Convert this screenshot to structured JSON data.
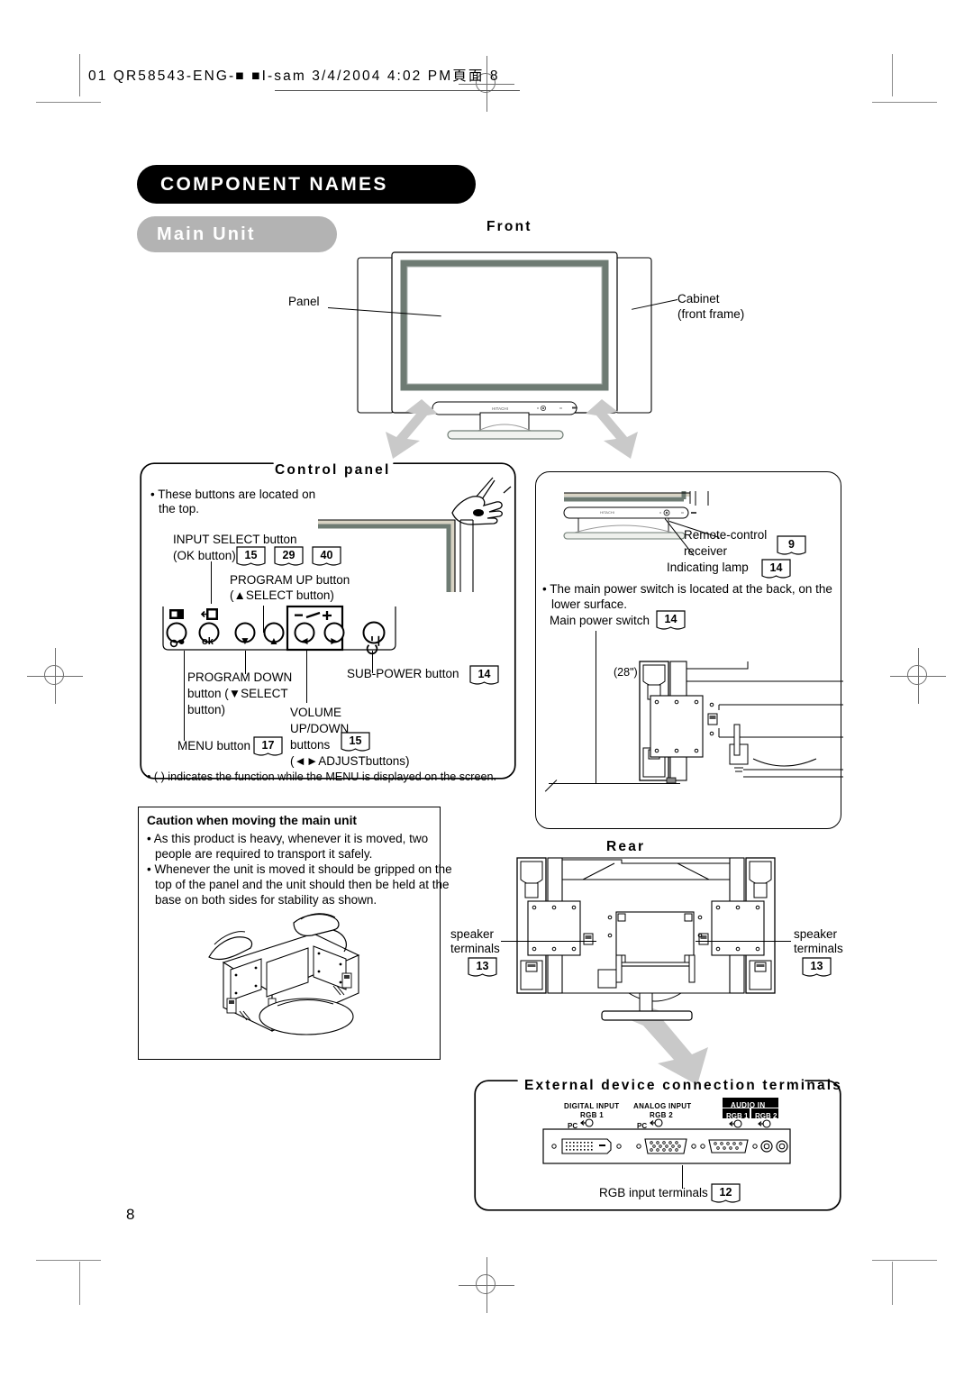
{
  "page": {
    "slug": "01 QR58543-ENG-■ ■I-sam  3/4/2004  4:02 PM頁面 8",
    "number": "8"
  },
  "title": {
    "main": "COMPONENT NAMES",
    "sub": "Main Unit"
  },
  "front": {
    "caption": "Front",
    "panel_label": "Panel",
    "cabinet_label_line1": "Cabinet",
    "cabinet_label_line2": "(front frame)"
  },
  "control_panel": {
    "caption": "Control panel",
    "note_line1": "• These buttons are located on",
    "note_line2": "the top.",
    "input_select_line1": "INPUT SELECT button",
    "input_select_line2": "(OK button)",
    "input_select_refs": [
      "15",
      "29",
      "40"
    ],
    "program_up_line1": "PROGRAM UP button",
    "program_up_line2": "(▲SELECT button)",
    "program_down_line1": "PROGRAM DOWN",
    "program_down_line2": "button (▼SELECT",
    "program_down_line3": "button)",
    "sub_power_label": "SUB-POWER button",
    "sub_power_ref": "14",
    "menu_label": "MENU button",
    "menu_ref": "17",
    "volume_line1": "VOLUME",
    "volume_line2": "UP/DOWN",
    "volume_line3": "buttons",
    "volume_ref": "15",
    "volume_line4": "(◄►ADJUSTbuttons)",
    "footnote": "• (  ) indicates the function while the MENU is displayed on the screen.",
    "button_glyphs": [
      "menu-glyph",
      "input-glyph",
      "down-glyph",
      "up-glyph",
      "volume-minus-glyph",
      "volume-plus-glyph",
      "power-glyph"
    ],
    "button_sublabels": [
      "♂",
      "ok",
      "▼",
      "▲",
      "◄",
      "►",
      "⏻"
    ]
  },
  "receiver": {
    "remote_line1": "Remote-control",
    "remote_line2": "receiver",
    "remote_ref": "9",
    "indicating_label": "Indicating lamp",
    "indicating_ref": "14",
    "note_line1": "• The main power switch is located at the back, on the",
    "note_line2": "lower surface.",
    "main_switch_label": "Main power switch",
    "main_switch_ref": "14",
    "size_label": "(28\")"
  },
  "caution": {
    "heading": "Caution when moving the main unit",
    "b1_l1": "• As this product is heavy, whenever it is moved, two",
    "b1_l2": "people are required to transport it safely.",
    "b2_l1": "• Whenever the unit is moved it should be gripped on the",
    "b2_l2": "top of the panel and the unit should then be held at the",
    "b2_l3": "base on both sides for stability as shown."
  },
  "rear": {
    "caption": "Rear",
    "left_l1": "speaker",
    "left_l2": "terminals",
    "left_ref": "13",
    "right_l1": "speaker",
    "right_l2": "terminals",
    "right_ref": "13"
  },
  "terminals": {
    "caption": "External device connection terminals",
    "digital_l1": "DIGITAL INPUT",
    "digital_l2": "RGB 1",
    "digital_l3": "PC",
    "analog_l1": "ANALOG INPUT",
    "analog_l2": "RGB 2",
    "analog_l3": "PC",
    "audio_in": "AUDIO IN",
    "audio_rgb1": "RGB 1",
    "audio_rgb2": "RGB 2",
    "rgb_input_label": "RGB input terminals",
    "rgb_input_ref": "12"
  },
  "colors": {
    "banner_black": "#000000",
    "banner_gray": "#b3b3b3",
    "arrow_gray": "#c9c9c9",
    "bezel_gray": "#6e7b73",
    "mark_gray": "#6f6f6f"
  }
}
